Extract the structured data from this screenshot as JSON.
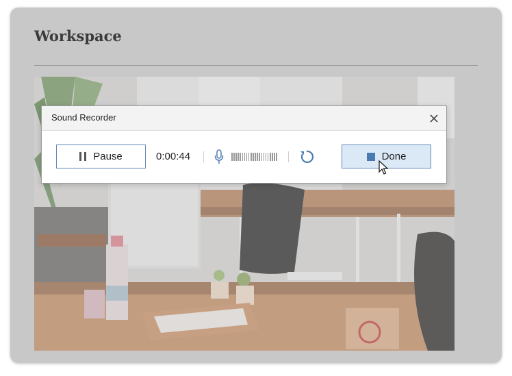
{
  "card": {
    "title": "Workspace"
  },
  "dialog": {
    "title": "Sound Recorder",
    "pause_label": "Pause",
    "timer": "0:00:44",
    "done_label": "Done",
    "icons": {
      "close": "close-icon",
      "pause": "pause-icon",
      "microphone": "microphone-icon",
      "level": "audio-level-meter",
      "restart": "restart-icon",
      "stop": "stop-icon"
    }
  },
  "colors": {
    "card_background": "#c8c8c9",
    "button_border": "#5f87b6",
    "done_background": "#dbe8f6",
    "accent_icon": "#4a7bb0"
  }
}
